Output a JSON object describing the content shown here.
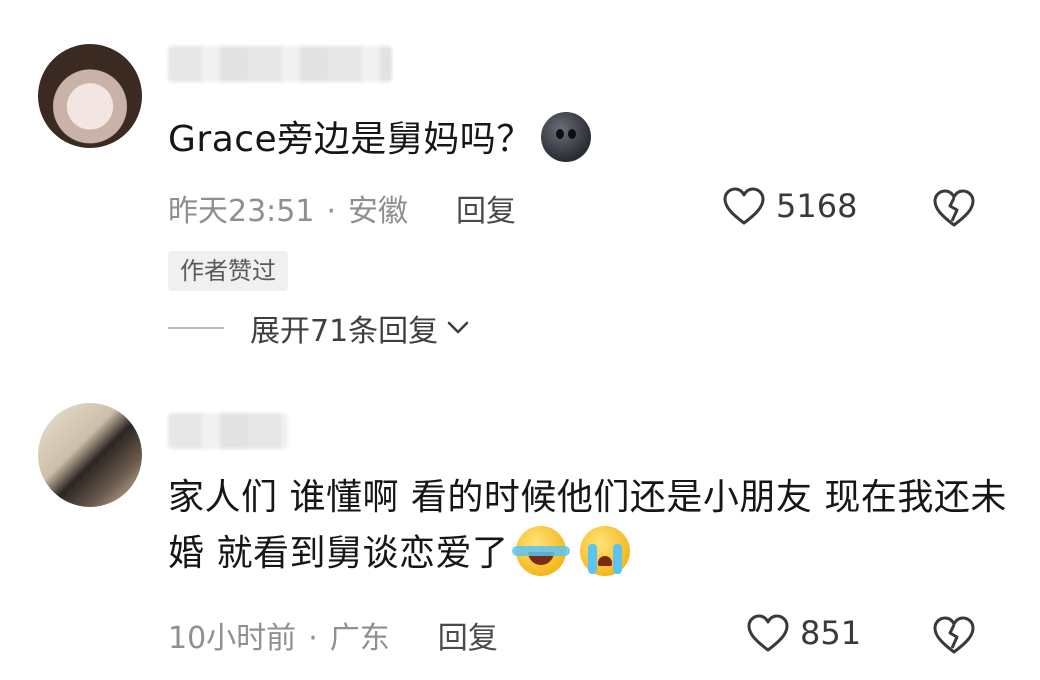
{
  "comments": [
    {
      "text": "Grace旁边是舅妈吗？",
      "time": "昨天23:51",
      "separator": "·",
      "location": "安徽",
      "reply_label": "回复",
      "likes": "5168",
      "badge": "作者赞过",
      "expand_label": "展开71条回复",
      "emoji": [
        "dark-face-emoji"
      ]
    },
    {
      "text": "家人们 谁懂啊 看的时候他们还是小朋友 现在我还未婚 就看到舅谈恋爱了",
      "time": "10小时前",
      "separator": "·",
      "location": "广东",
      "reply_label": "回复",
      "likes": "851",
      "emoji": [
        "laughing-crying-emoji",
        "crying-emoji"
      ]
    }
  ],
  "colors": {
    "text": "#161616",
    "meta": "#8f8f8f",
    "badge_bg": "#f0f0f0"
  }
}
